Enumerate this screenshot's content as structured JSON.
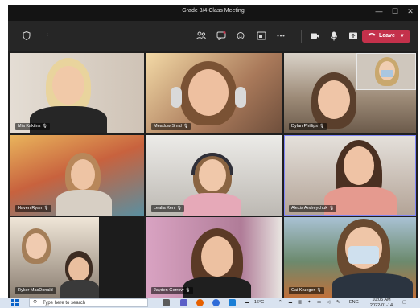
{
  "window": {
    "title": "Grade 3/4 Class Meeting",
    "minimize": "—",
    "maximize": "☐",
    "close": "✕"
  },
  "toolbar": {
    "timer": "--:--",
    "leave_label": "Leave",
    "icons": [
      "shield-icon",
      "people-icon",
      "chat-icon",
      "reactions-icon",
      "share-tray-icon",
      "more-icon",
      "camera-icon",
      "mic-icon",
      "share-icon",
      "phone-icon"
    ]
  },
  "participants": [
    {
      "name": "Mia Kaktins",
      "bg": "#d9cfc4"
    },
    {
      "name": "Meadow Smid",
      "bg": "#b88a66"
    },
    {
      "name": "Dylan Phillips",
      "bg": "#8c7a66"
    },
    {
      "name": "Haven Ryan",
      "bg": "#c26a4a"
    },
    {
      "name": "Lealia Kerr",
      "bg": "#c9c6c2"
    },
    {
      "name": "Alexis Andreychuk",
      "bg": "#b7aaa0"
    },
    {
      "name": "Ryker MacDonald",
      "bg": "#6e6a66"
    },
    {
      "name": "Jayden Gerrow",
      "bg": "#c795b3"
    },
    {
      "name": "Cai Krueger",
      "bg": "#6f8fa8"
    }
  ],
  "taskbar": {
    "search_placeholder": "Type here to search",
    "temperature": "-16°C",
    "language": "ENG",
    "time": "10:05 AM",
    "date": "2022-01-14"
  },
  "colors": {
    "leave": "#c4314b",
    "active_speaker": "#7f85f5"
  }
}
